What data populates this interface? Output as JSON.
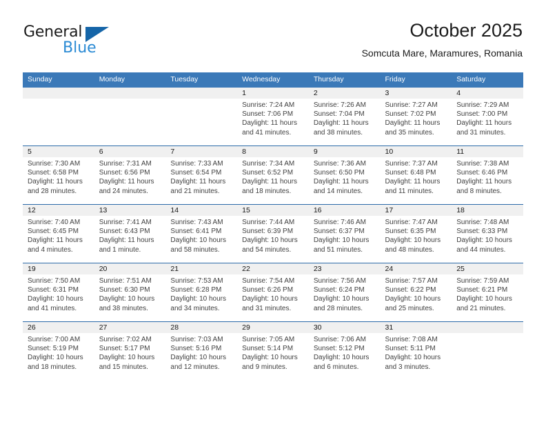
{
  "brand": {
    "name_part1": "General",
    "name_part2": "Blue",
    "accent_color": "#2a8ad4",
    "triangle_color": "#1565a8"
  },
  "header": {
    "title": "October 2025",
    "subtitle": "Somcuta Mare, Maramures, Romania"
  },
  "theme": {
    "header_blue": "#3b79b8",
    "row_divider_blue": "#2b6aa8",
    "daynum_band": "#f0f0f0"
  },
  "calendar": {
    "weekday_headers": [
      "Sunday",
      "Monday",
      "Tuesday",
      "Wednesday",
      "Thursday",
      "Friday",
      "Saturday"
    ],
    "weeks": [
      [
        {
          "day": "",
          "sunrise": "",
          "sunset": "",
          "daylight_line1": "",
          "daylight_line2": "",
          "empty": true
        },
        {
          "day": "",
          "sunrise": "",
          "sunset": "",
          "daylight_line1": "",
          "daylight_line2": "",
          "empty": true
        },
        {
          "day": "",
          "sunrise": "",
          "sunset": "",
          "daylight_line1": "",
          "daylight_line2": "",
          "empty": true
        },
        {
          "day": "1",
          "sunrise": "Sunrise: 7:24 AM",
          "sunset": "Sunset: 7:06 PM",
          "daylight_line1": "Daylight: 11 hours",
          "daylight_line2": "and 41 minutes."
        },
        {
          "day": "2",
          "sunrise": "Sunrise: 7:26 AM",
          "sunset": "Sunset: 7:04 PM",
          "daylight_line1": "Daylight: 11 hours",
          "daylight_line2": "and 38 minutes."
        },
        {
          "day": "3",
          "sunrise": "Sunrise: 7:27 AM",
          "sunset": "Sunset: 7:02 PM",
          "daylight_line1": "Daylight: 11 hours",
          "daylight_line2": "and 35 minutes."
        },
        {
          "day": "4",
          "sunrise": "Sunrise: 7:29 AM",
          "sunset": "Sunset: 7:00 PM",
          "daylight_line1": "Daylight: 11 hours",
          "daylight_line2": "and 31 minutes."
        }
      ],
      [
        {
          "day": "5",
          "sunrise": "Sunrise: 7:30 AM",
          "sunset": "Sunset: 6:58 PM",
          "daylight_line1": "Daylight: 11 hours",
          "daylight_line2": "and 28 minutes."
        },
        {
          "day": "6",
          "sunrise": "Sunrise: 7:31 AM",
          "sunset": "Sunset: 6:56 PM",
          "daylight_line1": "Daylight: 11 hours",
          "daylight_line2": "and 24 minutes."
        },
        {
          "day": "7",
          "sunrise": "Sunrise: 7:33 AM",
          "sunset": "Sunset: 6:54 PM",
          "daylight_line1": "Daylight: 11 hours",
          "daylight_line2": "and 21 minutes."
        },
        {
          "day": "8",
          "sunrise": "Sunrise: 7:34 AM",
          "sunset": "Sunset: 6:52 PM",
          "daylight_line1": "Daylight: 11 hours",
          "daylight_line2": "and 18 minutes."
        },
        {
          "day": "9",
          "sunrise": "Sunrise: 7:36 AM",
          "sunset": "Sunset: 6:50 PM",
          "daylight_line1": "Daylight: 11 hours",
          "daylight_line2": "and 14 minutes."
        },
        {
          "day": "10",
          "sunrise": "Sunrise: 7:37 AM",
          "sunset": "Sunset: 6:48 PM",
          "daylight_line1": "Daylight: 11 hours",
          "daylight_line2": "and 11 minutes."
        },
        {
          "day": "11",
          "sunrise": "Sunrise: 7:38 AM",
          "sunset": "Sunset: 6:46 PM",
          "daylight_line1": "Daylight: 11 hours",
          "daylight_line2": "and 8 minutes."
        }
      ],
      [
        {
          "day": "12",
          "sunrise": "Sunrise: 7:40 AM",
          "sunset": "Sunset: 6:45 PM",
          "daylight_line1": "Daylight: 11 hours",
          "daylight_line2": "and 4 minutes."
        },
        {
          "day": "13",
          "sunrise": "Sunrise: 7:41 AM",
          "sunset": "Sunset: 6:43 PM",
          "daylight_line1": "Daylight: 11 hours",
          "daylight_line2": "and 1 minute."
        },
        {
          "day": "14",
          "sunrise": "Sunrise: 7:43 AM",
          "sunset": "Sunset: 6:41 PM",
          "daylight_line1": "Daylight: 10 hours",
          "daylight_line2": "and 58 minutes."
        },
        {
          "day": "15",
          "sunrise": "Sunrise: 7:44 AM",
          "sunset": "Sunset: 6:39 PM",
          "daylight_line1": "Daylight: 10 hours",
          "daylight_line2": "and 54 minutes."
        },
        {
          "day": "16",
          "sunrise": "Sunrise: 7:46 AM",
          "sunset": "Sunset: 6:37 PM",
          "daylight_line1": "Daylight: 10 hours",
          "daylight_line2": "and 51 minutes."
        },
        {
          "day": "17",
          "sunrise": "Sunrise: 7:47 AM",
          "sunset": "Sunset: 6:35 PM",
          "daylight_line1": "Daylight: 10 hours",
          "daylight_line2": "and 48 minutes."
        },
        {
          "day": "18",
          "sunrise": "Sunrise: 7:48 AM",
          "sunset": "Sunset: 6:33 PM",
          "daylight_line1": "Daylight: 10 hours",
          "daylight_line2": "and 44 minutes."
        }
      ],
      [
        {
          "day": "19",
          "sunrise": "Sunrise: 7:50 AM",
          "sunset": "Sunset: 6:31 PM",
          "daylight_line1": "Daylight: 10 hours",
          "daylight_line2": "and 41 minutes."
        },
        {
          "day": "20",
          "sunrise": "Sunrise: 7:51 AM",
          "sunset": "Sunset: 6:30 PM",
          "daylight_line1": "Daylight: 10 hours",
          "daylight_line2": "and 38 minutes."
        },
        {
          "day": "21",
          "sunrise": "Sunrise: 7:53 AM",
          "sunset": "Sunset: 6:28 PM",
          "daylight_line1": "Daylight: 10 hours",
          "daylight_line2": "and 34 minutes."
        },
        {
          "day": "22",
          "sunrise": "Sunrise: 7:54 AM",
          "sunset": "Sunset: 6:26 PM",
          "daylight_line1": "Daylight: 10 hours",
          "daylight_line2": "and 31 minutes."
        },
        {
          "day": "23",
          "sunrise": "Sunrise: 7:56 AM",
          "sunset": "Sunset: 6:24 PM",
          "daylight_line1": "Daylight: 10 hours",
          "daylight_line2": "and 28 minutes."
        },
        {
          "day": "24",
          "sunrise": "Sunrise: 7:57 AM",
          "sunset": "Sunset: 6:22 PM",
          "daylight_line1": "Daylight: 10 hours",
          "daylight_line2": "and 25 minutes."
        },
        {
          "day": "25",
          "sunrise": "Sunrise: 7:59 AM",
          "sunset": "Sunset: 6:21 PM",
          "daylight_line1": "Daylight: 10 hours",
          "daylight_line2": "and 21 minutes."
        }
      ],
      [
        {
          "day": "26",
          "sunrise": "Sunrise: 7:00 AM",
          "sunset": "Sunset: 5:19 PM",
          "daylight_line1": "Daylight: 10 hours",
          "daylight_line2": "and 18 minutes."
        },
        {
          "day": "27",
          "sunrise": "Sunrise: 7:02 AM",
          "sunset": "Sunset: 5:17 PM",
          "daylight_line1": "Daylight: 10 hours",
          "daylight_line2": "and 15 minutes."
        },
        {
          "day": "28",
          "sunrise": "Sunrise: 7:03 AM",
          "sunset": "Sunset: 5:16 PM",
          "daylight_line1": "Daylight: 10 hours",
          "daylight_line2": "and 12 minutes."
        },
        {
          "day": "29",
          "sunrise": "Sunrise: 7:05 AM",
          "sunset": "Sunset: 5:14 PM",
          "daylight_line1": "Daylight: 10 hours",
          "daylight_line2": "and 9 minutes."
        },
        {
          "day": "30",
          "sunrise": "Sunrise: 7:06 AM",
          "sunset": "Sunset: 5:12 PM",
          "daylight_line1": "Daylight: 10 hours",
          "daylight_line2": "and 6 minutes."
        },
        {
          "day": "31",
          "sunrise": "Sunrise: 7:08 AM",
          "sunset": "Sunset: 5:11 PM",
          "daylight_line1": "Daylight: 10 hours",
          "daylight_line2": "and 3 minutes."
        },
        {
          "day": "",
          "sunrise": "",
          "sunset": "",
          "daylight_line1": "",
          "daylight_line2": "",
          "empty": true
        }
      ]
    ]
  }
}
